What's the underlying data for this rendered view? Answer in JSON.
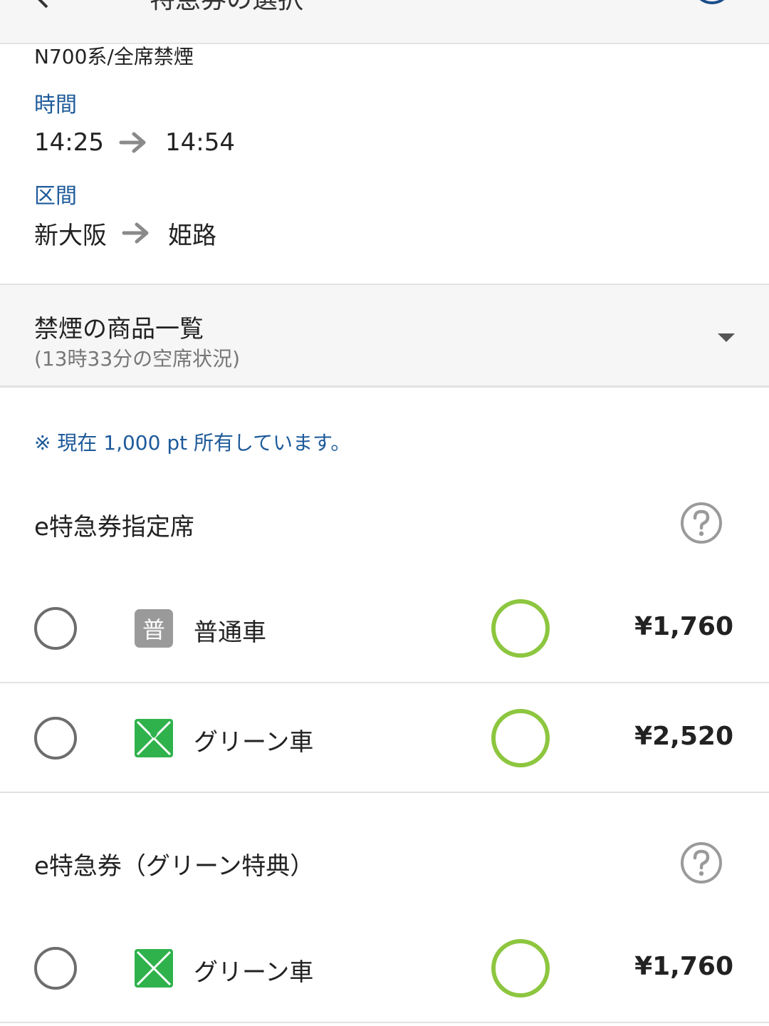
{
  "app_bar": {
    "title": "特急券の選択"
  },
  "train": {
    "type": "N700系/全席禁煙",
    "time_label": "時間",
    "depart_time": "14:25",
    "arrive_time": "14:54",
    "section_label": "区間",
    "from_station": "新大阪",
    "to_station": "姫路"
  },
  "product_list": {
    "title": "禁煙の商品一覧",
    "subtitle": "(13時33分の空席状況)"
  },
  "points_note": "※ 現在 1,000 pt 所有しています。",
  "products": [
    {
      "heading": "e特急券指定席",
      "options": [
        {
          "badge": "普",
          "car": "普通車",
          "availability": "○",
          "price": "¥1,760"
        },
        {
          "car": "グリーン車",
          "availability": "○",
          "price": "¥2,520"
        }
      ]
    },
    {
      "heading": "e特急券（グリーン特典）",
      "options": [
        {
          "car": "グリーン車",
          "availability": "○",
          "price": "¥1,760"
        }
      ]
    }
  ],
  "colors": {
    "accent_blue": "#1e5a9a",
    "available_green": "#8dc63f",
    "green_car": "#2fb24c"
  }
}
